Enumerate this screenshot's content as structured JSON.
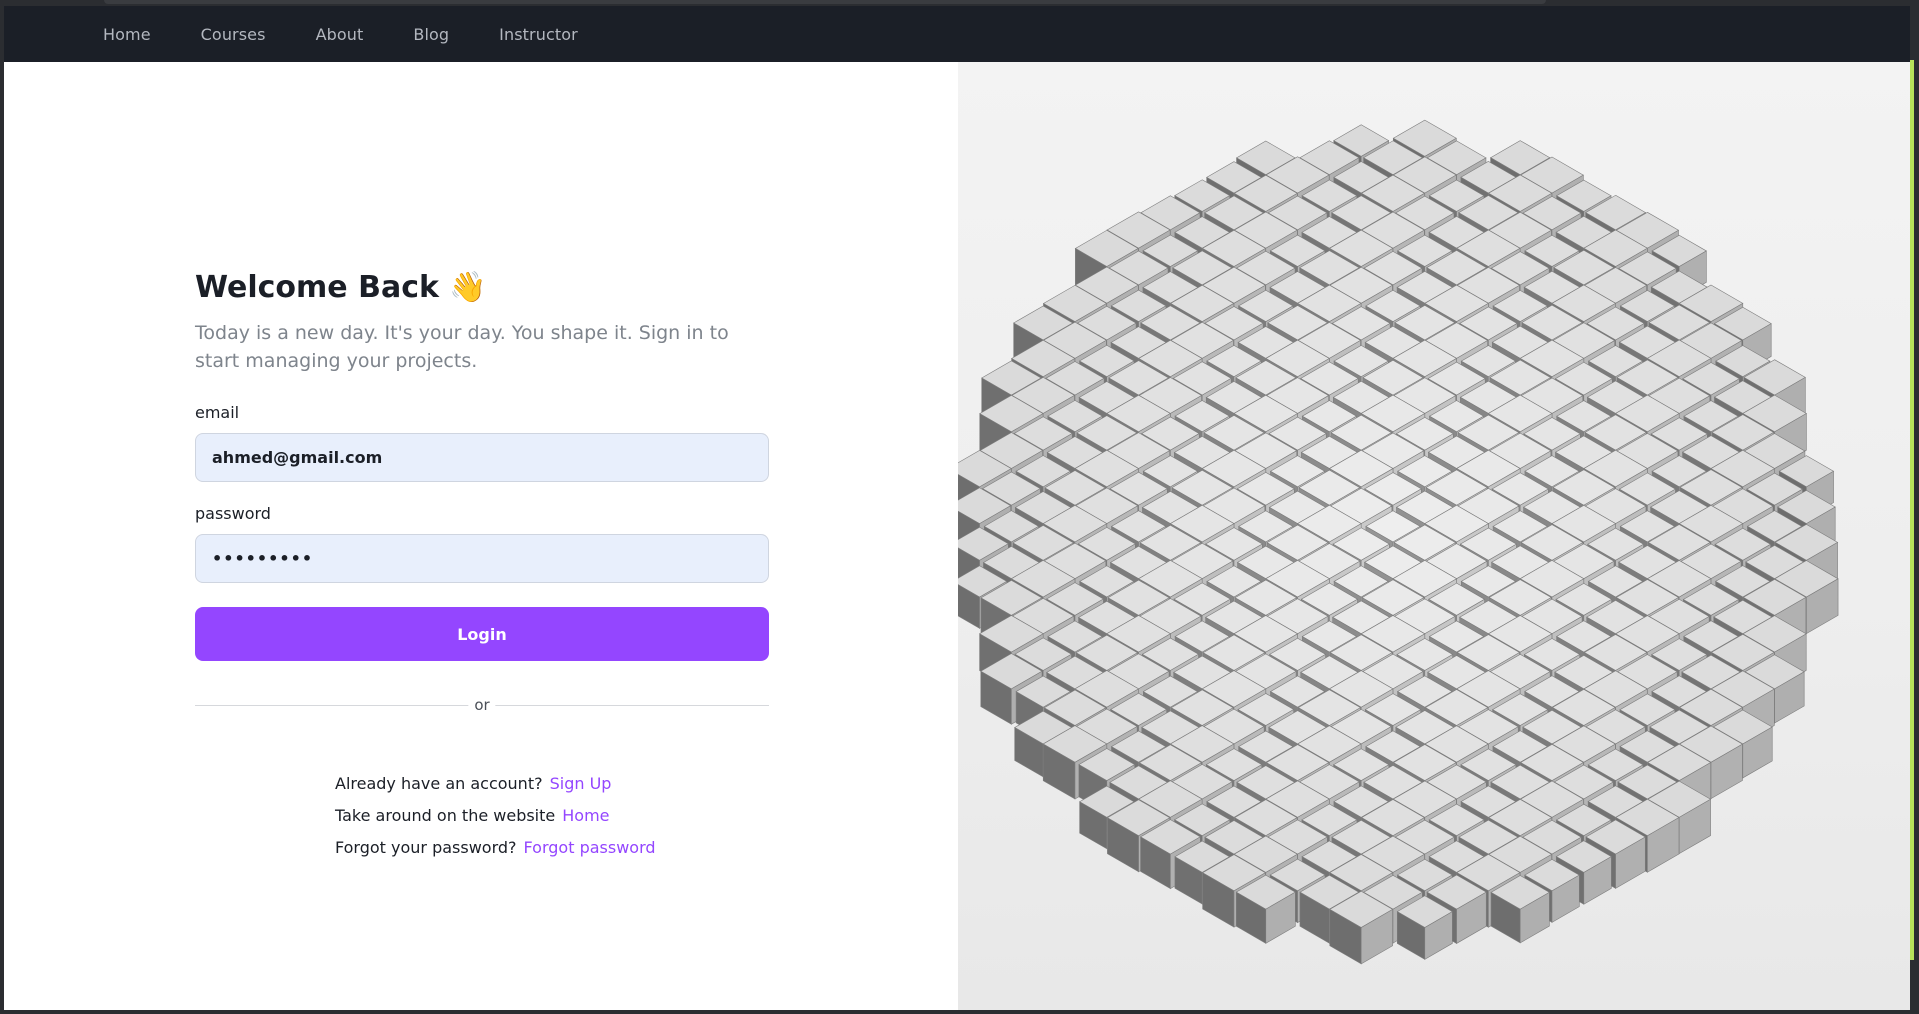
{
  "nav": {
    "items": [
      "Home",
      "Courses",
      "About",
      "Blog",
      "Instructor"
    ]
  },
  "login": {
    "title": "Welcome Back",
    "title_emoji": "👋",
    "subtitle": "Today is a new day. It's your day. You shape it. Sign in to start managing your projects.",
    "email_label": "email",
    "email_value": "ahmed@gmail.com",
    "password_label": "password",
    "password_value": "•••••••••",
    "login_button": "Login",
    "divider_text": "or"
  },
  "links": {
    "signup_prompt": "Already have an account?",
    "signup_link": "Sign Up",
    "home_prompt": "Take around on the website",
    "home_link": "Home",
    "forgot_prompt": "Forgot your password?",
    "forgot_link": "Forgot password"
  },
  "colors": {
    "accent": "#9446ff",
    "navbar": "#1b1f27",
    "input_bg": "#e8effc"
  },
  "hero": {
    "icon": "cube-sphere-illustration"
  }
}
